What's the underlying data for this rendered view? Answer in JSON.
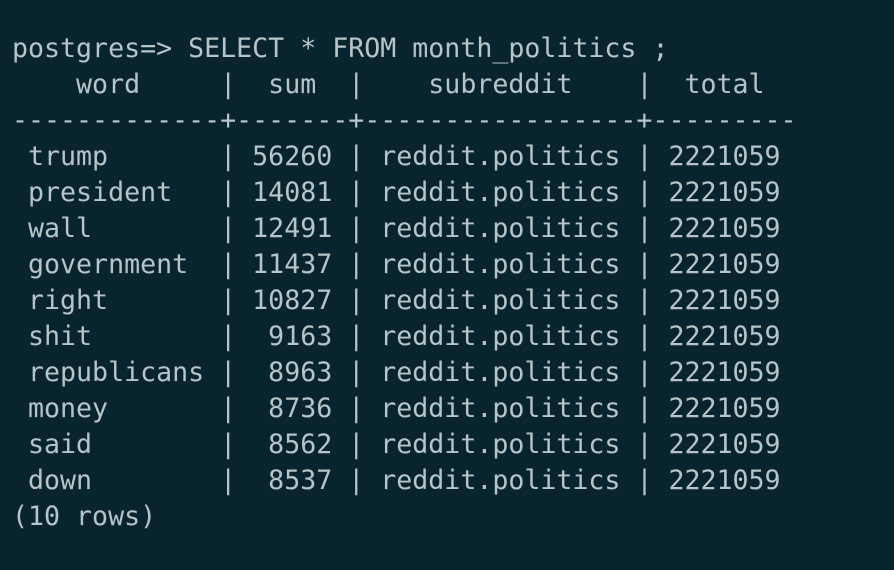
{
  "terminal": {
    "prompt": "postgres=> ",
    "command": "SELECT * FROM month_politics ;",
    "columns": [
      "word",
      "sum",
      "subreddit",
      "total"
    ],
    "rows": [
      {
        "word": "trump",
        "sum": "56260",
        "subreddit": "reddit.politics",
        "total": "2221059"
      },
      {
        "word": "president",
        "sum": "14081",
        "subreddit": "reddit.politics",
        "total": "2221059"
      },
      {
        "word": "wall",
        "sum": "12491",
        "subreddit": "reddit.politics",
        "total": "2221059"
      },
      {
        "word": "government",
        "sum": "11437",
        "subreddit": "reddit.politics",
        "total": "2221059"
      },
      {
        "word": "right",
        "sum": "10827",
        "subreddit": "reddit.politics",
        "total": "2221059"
      },
      {
        "word": "shit",
        "sum": "9163",
        "subreddit": "reddit.politics",
        "total": "2221059"
      },
      {
        "word": "republicans",
        "sum": "8963",
        "subreddit": "reddit.politics",
        "total": "2221059"
      },
      {
        "word": "money",
        "sum": "8736",
        "subreddit": "reddit.politics",
        "total": "2221059"
      },
      {
        "word": "said",
        "sum": "8562",
        "subreddit": "reddit.politics",
        "total": "2221059"
      },
      {
        "word": "down",
        "sum": "8537",
        "subreddit": "reddit.politics",
        "total": "2221059"
      }
    ],
    "footer": "(10 rows)",
    "colors": {
      "background": "#08242e",
      "foreground": "#b7c5c9"
    }
  }
}
